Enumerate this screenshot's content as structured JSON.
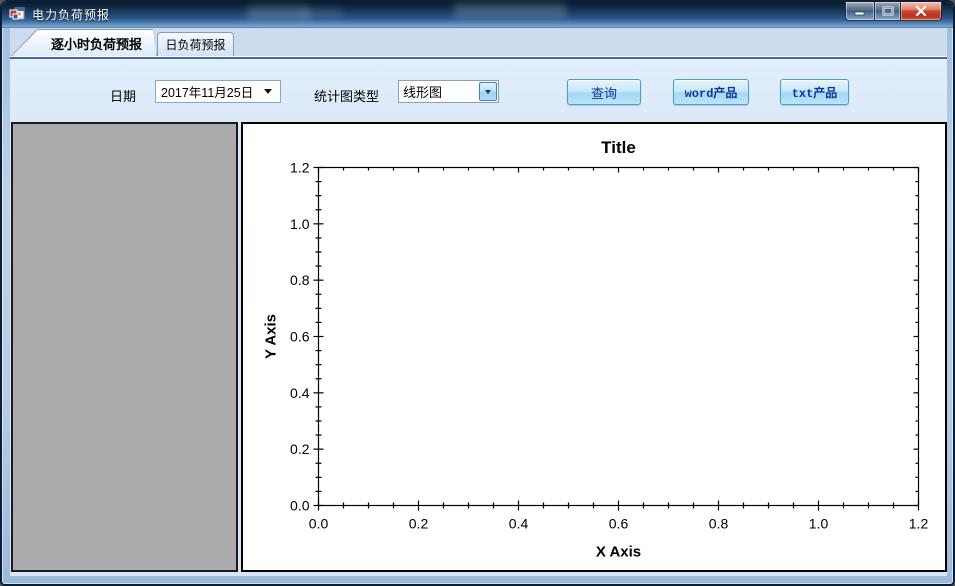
{
  "window": {
    "title": "电力负荷预报",
    "controls": [
      {
        "name": "minimize",
        "icon": "minimize-icon"
      },
      {
        "name": "maximize",
        "icon": "maximize-icon"
      },
      {
        "name": "close",
        "icon": "close-icon"
      }
    ],
    "app_icon": "winforms-app-icon"
  },
  "tabs": [
    {
      "label": "逐小时负荷预报",
      "selected": true
    },
    {
      "label": "日负荷预报",
      "selected": false
    }
  ],
  "toolbar": {
    "date_label": "日期",
    "date_value": "2017年11月25日",
    "date_dropdown_icon": "caret-down-icon",
    "chart_type_label": "统计图类型",
    "chart_type_value": "线形图",
    "chart_type_dropdown_icon": "caret-down-icon",
    "buttons": {
      "query": "查询",
      "word": "word产品",
      "txt": "txt产品"
    }
  },
  "chart_data": {
    "type": "line",
    "title": "Title",
    "xlabel": "X Axis",
    "ylabel": "Y Axis",
    "xlim": [
      0,
      1.2
    ],
    "ylim": [
      0,
      1.2
    ],
    "x_ticks": [
      0,
      0.2,
      0.4,
      0.6,
      0.8,
      1.0,
      1.2
    ],
    "y_ticks": [
      0,
      0.2,
      0.4,
      0.6,
      0.8,
      1.0,
      1.2
    ],
    "x_minor_step": 0.05,
    "y_minor_step": 0.05,
    "tick_format_decimals": 1,
    "grid": false,
    "legend": "none",
    "series": []
  },
  "colors": {
    "titlebar_top": "#081a30",
    "titlebar_bottom": "#7ea8d1",
    "frame_glass": "#bdd3ec",
    "close_red": "#cf4630",
    "tabpage_bg": "#d6e5f7",
    "button_face": "#bfe6f8",
    "button_border": "#4e9cd2",
    "button_text": "#15339b",
    "left_panel_gray": "#ababab",
    "chart_bg": "#ffffff",
    "axis_color": "#000000"
  }
}
